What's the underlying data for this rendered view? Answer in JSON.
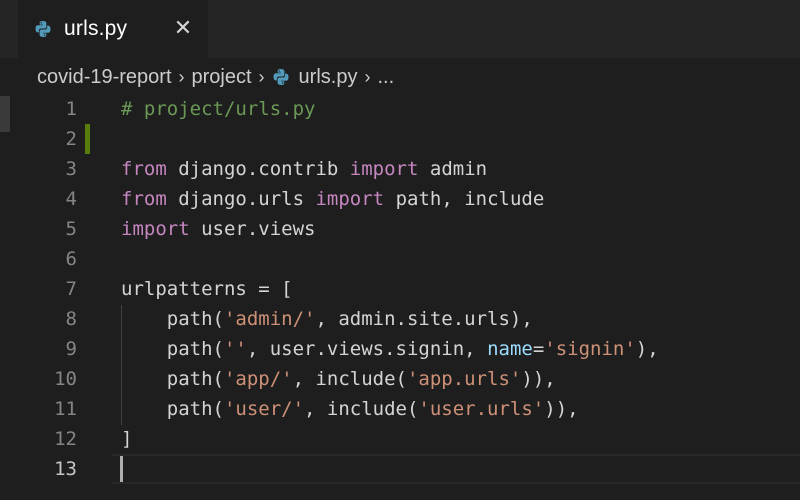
{
  "tab": {
    "title": "urls.py",
    "icon": "python-file-icon",
    "close_glyph": "✕"
  },
  "breadcrumb": {
    "items": [
      "covid-19-report",
      "project",
      "urls.py",
      "..."
    ],
    "separator": "›"
  },
  "colors": {
    "background": "#1e1e1e",
    "tabbar": "#252526",
    "comment": "#6a9955",
    "keyword": "#c586c0",
    "string": "#ce9178",
    "parameter": "#9cdcfe",
    "text": "#d4d4d4",
    "line_number": "#858585",
    "modified_gutter": "#587c0c"
  },
  "editor": {
    "lines": [
      {
        "n": "1",
        "tokens": [
          {
            "t": "# project/urls.py",
            "c": "cmt"
          }
        ]
      },
      {
        "n": "2",
        "tokens": [],
        "modified": true
      },
      {
        "n": "3",
        "tokens": [
          {
            "t": "from",
            "c": "kw"
          },
          {
            "t": " django.contrib "
          },
          {
            "t": "import",
            "c": "kw"
          },
          {
            "t": " admin"
          }
        ]
      },
      {
        "n": "4",
        "tokens": [
          {
            "t": "from",
            "c": "kw"
          },
          {
            "t": " django.urls "
          },
          {
            "t": "import",
            "c": "kw"
          },
          {
            "t": " path, include"
          }
        ]
      },
      {
        "n": "5",
        "tokens": [
          {
            "t": "import",
            "c": "kw"
          },
          {
            "t": " user.views"
          }
        ]
      },
      {
        "n": "6",
        "tokens": []
      },
      {
        "n": "7",
        "tokens": [
          {
            "t": "urlpatterns = ["
          }
        ]
      },
      {
        "n": "8",
        "tokens": [
          {
            "t": "    path("
          },
          {
            "t": "'admin/'",
            "c": "str"
          },
          {
            "t": ", admin.site.urls),"
          }
        ]
      },
      {
        "n": "9",
        "tokens": [
          {
            "t": "    path("
          },
          {
            "t": "''",
            "c": "str"
          },
          {
            "t": ", user.views.signin, "
          },
          {
            "t": "name",
            "c": "param"
          },
          {
            "t": "="
          },
          {
            "t": "'signin'",
            "c": "str"
          },
          {
            "t": "),"
          }
        ]
      },
      {
        "n": "10",
        "tokens": [
          {
            "t": "    path("
          },
          {
            "t": "'app/'",
            "c": "str"
          },
          {
            "t": ", include("
          },
          {
            "t": "'app.urls'",
            "c": "str"
          },
          {
            "t": ")),"
          }
        ]
      },
      {
        "n": "11",
        "tokens": [
          {
            "t": "    path("
          },
          {
            "t": "'user/'",
            "c": "str"
          },
          {
            "t": ", include("
          },
          {
            "t": "'user.urls'",
            "c": "str"
          },
          {
            "t": ")),"
          }
        ]
      },
      {
        "n": "12",
        "tokens": [
          {
            "t": "]"
          }
        ]
      },
      {
        "n": "13",
        "tokens": [],
        "active": true
      }
    ]
  }
}
